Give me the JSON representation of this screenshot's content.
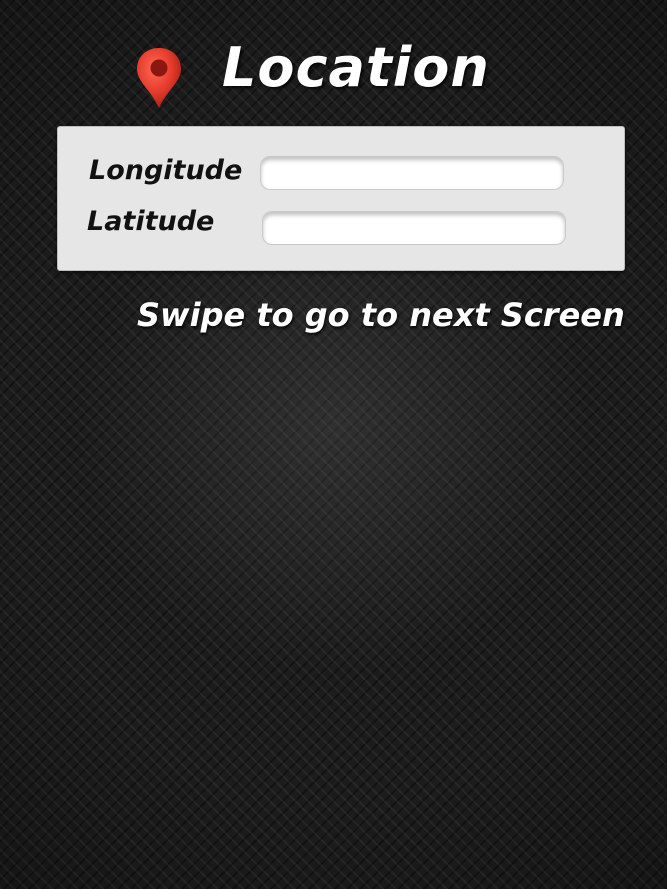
{
  "header": {
    "title": "Location",
    "icon": "map-pin-icon",
    "icon_color": "#e53b2c"
  },
  "form": {
    "longitude": {
      "label": "Longitude",
      "value": "",
      "placeholder": ""
    },
    "latitude": {
      "label": "Latitude",
      "value": "",
      "placeholder": ""
    }
  },
  "hint": {
    "text": "Swipe to go to next Screen"
  },
  "colors": {
    "background": "#1c1c1c",
    "panel": "#e6e6e6",
    "title_text": "#ffffff",
    "label_text": "#111111"
  }
}
